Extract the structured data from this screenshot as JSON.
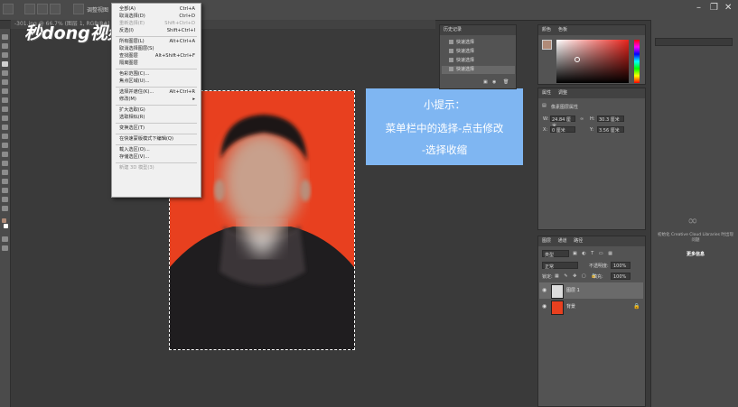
{
  "options_bar": {
    "fragment_label": "调整视图",
    "zoom_fragment": "66.7%",
    "doc_tab_fragment": "-301.jpg @ 66.7% (图层 1, RGB/8#)"
  },
  "watermark": {
    "text": "秒dong视频"
  },
  "select_menu": {
    "items": [
      {
        "label": "全部(A)",
        "shortcut": "Ctrl+A",
        "disabled": false
      },
      {
        "label": "取消选择(D)",
        "shortcut": "Ctrl+D",
        "disabled": false
      },
      {
        "label": "重新选择(E)",
        "shortcut": "Shift+Ctrl+D",
        "disabled": true
      },
      {
        "label": "反选(I)",
        "shortcut": "Shift+Ctrl+I",
        "disabled": false
      },
      {
        "label": "所有图层(L)",
        "shortcut": "Alt+Ctrl+A",
        "disabled": false
      },
      {
        "label": "取消选择图层(S)",
        "shortcut": "",
        "disabled": false
      },
      {
        "label": "查找图层",
        "shortcut": "Alt+Shift+Ctrl+F",
        "disabled": false
      },
      {
        "label": "隔离图层",
        "shortcut": "",
        "disabled": false
      },
      {
        "label": "色彩范围(C)...",
        "shortcut": "",
        "disabled": false
      },
      {
        "label": "焦点区域(U)...",
        "shortcut": "",
        "disabled": false
      },
      {
        "label": "选择并遮住(K)...",
        "shortcut": "Alt+Ctrl+R",
        "disabled": false
      },
      {
        "label": "修改(M)",
        "shortcut": "▸",
        "disabled": false
      },
      {
        "label": "扩大选取(G)",
        "shortcut": "",
        "disabled": false
      },
      {
        "label": "选取相似(R)",
        "shortcut": "",
        "disabled": false
      },
      {
        "label": "变换选区(T)",
        "shortcut": "",
        "disabled": false
      },
      {
        "label": "在快速蒙版模式下编辑(Q)",
        "shortcut": "",
        "disabled": false
      },
      {
        "label": "载入选区(O)...",
        "shortcut": "",
        "disabled": false
      },
      {
        "label": "存储选区(V)...",
        "shortcut": "",
        "disabled": false
      },
      {
        "label": "新建 3D 模型(3)",
        "shortcut": "",
        "disabled": true
      }
    ]
  },
  "tip": {
    "title": "小提示：",
    "line1": "菜单栏中的选择-点击修改",
    "line2": "-选择收缩"
  },
  "history_panel": {
    "tab": "历史记录",
    "items": [
      "快速选择",
      "快速选择",
      "快速选择",
      "快速选择"
    ]
  },
  "color_panel": {
    "tab1": "颜色",
    "tab2": "色板",
    "fg_color": "#b08b78",
    "bg_color": "#ffffff",
    "hue_color": "#e8241c"
  },
  "properties_panel": {
    "tab1": "属性",
    "tab2": "调整",
    "section": "像素图层属性",
    "w_label": "W:",
    "w_value": "24.84 厘米",
    "h_label": "H:",
    "h_value": "30.3 厘米",
    "x_label": "X:",
    "x_value": "0 厘米",
    "y_label": "Y:",
    "y_value": "3.56 厘米",
    "link_label": "GO"
  },
  "libraries": {
    "message": "初始化 Creative Cloud Libraries 时出现问题",
    "link": "更多信息"
  },
  "layers_panel": {
    "tabs": [
      "图层",
      "通道",
      "路径"
    ],
    "filter": "类型",
    "blend": "正常",
    "opacity_label": "不透明度:",
    "opacity_value": "100%",
    "fill_label": "填充:",
    "fill_value": "100%",
    "lock_label": "锁定:",
    "layers": [
      {
        "name": "图层 1",
        "selected": true
      },
      {
        "name": "背景",
        "selected": false
      }
    ]
  }
}
